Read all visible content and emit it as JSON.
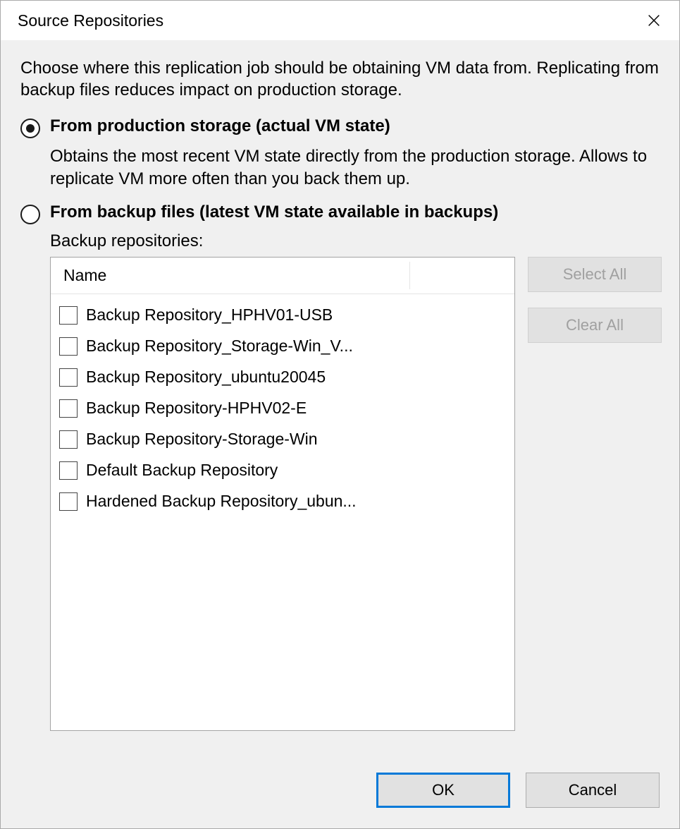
{
  "window": {
    "title": "Source Repositories"
  },
  "intro": "Choose where this replication job should be obtaining VM data from. Replicating from backup files reduces impact on production storage.",
  "options": {
    "production": {
      "label": "From production storage (actual VM state)",
      "desc": "Obtains the most recent VM state directly from the production storage. Allows to replicate VM more often than you back them up.",
      "selected": true
    },
    "backup": {
      "label": "From backup files (latest VM state available in backups)",
      "sublabel": "Backup repositories:",
      "selected": false
    }
  },
  "list": {
    "header": "Name",
    "items": [
      {
        "label": "Backup Repository_HPHV01-USB",
        "checked": false
      },
      {
        "label": "Backup Repository_Storage-Win_V...",
        "checked": false
      },
      {
        "label": "Backup Repository_ubuntu20045",
        "checked": false
      },
      {
        "label": "Backup Repository-HPHV02-E",
        "checked": false
      },
      {
        "label": "Backup Repository-Storage-Win",
        "checked": false
      },
      {
        "label": "Default Backup Repository",
        "checked": false
      },
      {
        "label": "Hardened Backup Repository_ubun...",
        "checked": false
      }
    ]
  },
  "buttons": {
    "select_all": "Select All",
    "clear_all": "Clear All",
    "ok": "OK",
    "cancel": "Cancel"
  }
}
